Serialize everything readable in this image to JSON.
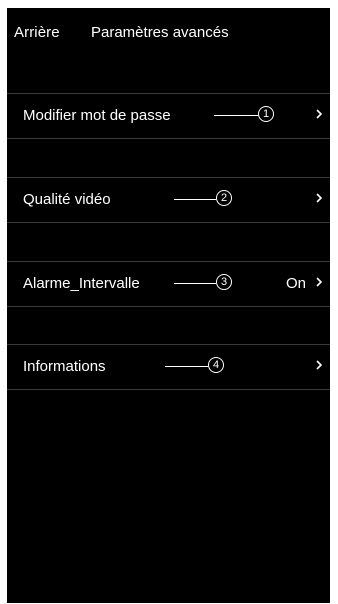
{
  "navbar": {
    "back_label": "Arrière",
    "title": "Paramètres avancés"
  },
  "rows": [
    {
      "label": "Modifier mot de passe",
      "callout": "1",
      "value": "",
      "icon": "chevron-right-icon"
    },
    {
      "label": "Qualité vidéo",
      "callout": "2",
      "value": "",
      "icon": "chevron-right-icon"
    },
    {
      "label": "Alarme_Intervalle",
      "callout": "3",
      "value": "On",
      "icon": "chevron-right-icon"
    },
    {
      "label": "Informations",
      "callout": "4",
      "value": "",
      "icon": "chevron-right-icon"
    }
  ]
}
